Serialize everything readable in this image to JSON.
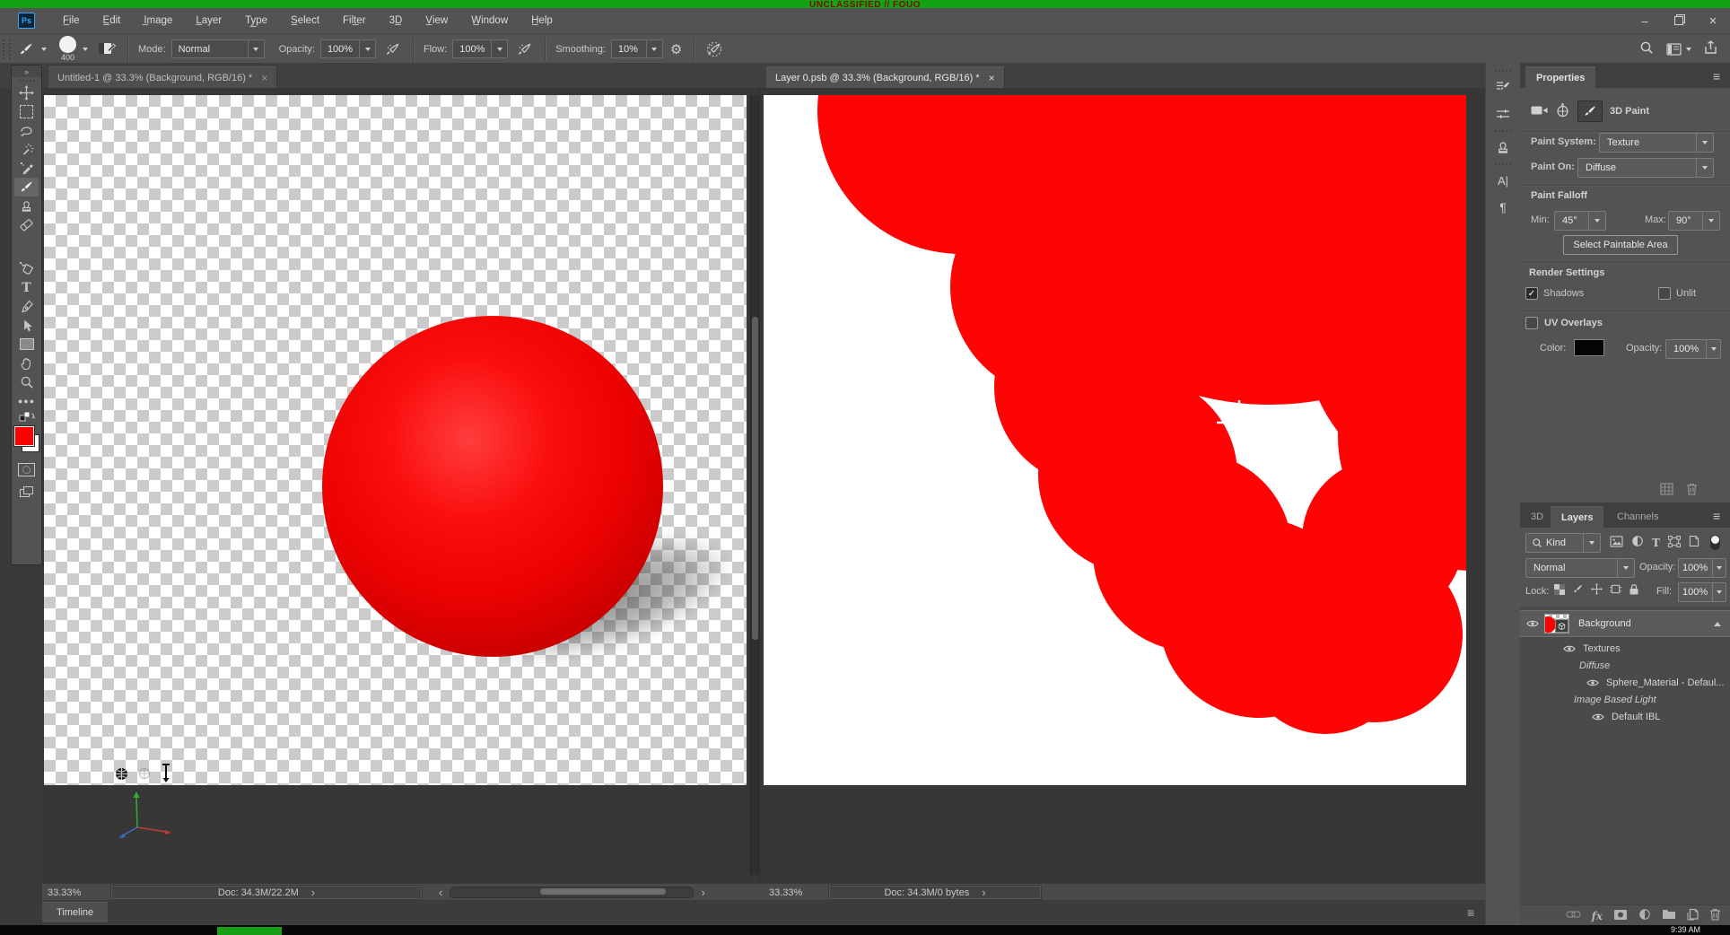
{
  "banner": {
    "text": "UNCLASSIFIED // FOUO",
    "bg": "#12a312",
    "fg": "#7e0b0b"
  },
  "titlebar": {
    "logo": "Ps"
  },
  "menu": {
    "items": [
      "F̲ile",
      "E̲dit",
      "I̲mage",
      "L̲ayer",
      "Ty̲pe",
      "S̲elect",
      "Filt̲er",
      "3D̲",
      "V̲iew",
      "W̲indow",
      "H̲elp"
    ]
  },
  "options": {
    "brush_size": "400",
    "mode_label": "Mode:",
    "mode_value": "Normal",
    "opacity_label": "Opacity:",
    "opacity_value": "100%",
    "flow_label": "Flow:",
    "flow_value": "100%",
    "smoothing_label": "Smoothing:",
    "smoothing_value": "10%"
  },
  "tabs": {
    "doc1": "Untitled-1 @ 33.3% (Background, RGB/16) *",
    "doc2": "Layer 0.psb @ 33.3% (Background, RGB/16) *",
    "close": "×"
  },
  "status_left": {
    "zoom": "33.33%",
    "doc": "Doc: 34.3M/22.2M"
  },
  "status_right": {
    "zoom": "33.33%",
    "doc": "Doc: 34.3M/0 bytes"
  },
  "properties": {
    "tab": "Properties",
    "tool_label": "3D Paint",
    "paint_system_label": "Paint System:",
    "paint_system_value": "Texture",
    "paint_on_label": "Paint On:",
    "paint_on_value": "Diffuse",
    "falloff_title": "Paint Falloff",
    "min_label": "Min:",
    "min_value": "45°",
    "max_label": "Max:",
    "max_value": "90°",
    "select_button": "Select Paintable Area",
    "render_title": "Render Settings",
    "shadows_label": "Shadows",
    "unlit_label": "Unlit",
    "uv_label": "UV Overlays",
    "color_label": "Color:",
    "opacity_label": "Opacity:",
    "opacity_value": "100%"
  },
  "layers": {
    "tab_3d": "3D",
    "tab_layers": "Layers",
    "tab_channels": "Channels",
    "kind": "Kind",
    "blend": "Normal",
    "opacity_label": "Opacity:",
    "opacity_value": "100%",
    "lock_label": "Lock:",
    "fill_label": "Fill:",
    "fill_value": "100%",
    "rows": [
      {
        "name": "Background"
      },
      {
        "name": "Textures"
      },
      {
        "name": "Diffuse"
      },
      {
        "name": "Sphere_Material - Defaul..."
      },
      {
        "name": "Image Based Light"
      },
      {
        "name": "Default IBL"
      }
    ]
  },
  "timeline": {
    "tab": "Timeline"
  },
  "taskbar": {
    "clock": "9:39 AM"
  },
  "colors": {
    "banner_green": "#12a312",
    "paint_red": "#fe0404",
    "foreground_swatch": "#fe0000"
  }
}
